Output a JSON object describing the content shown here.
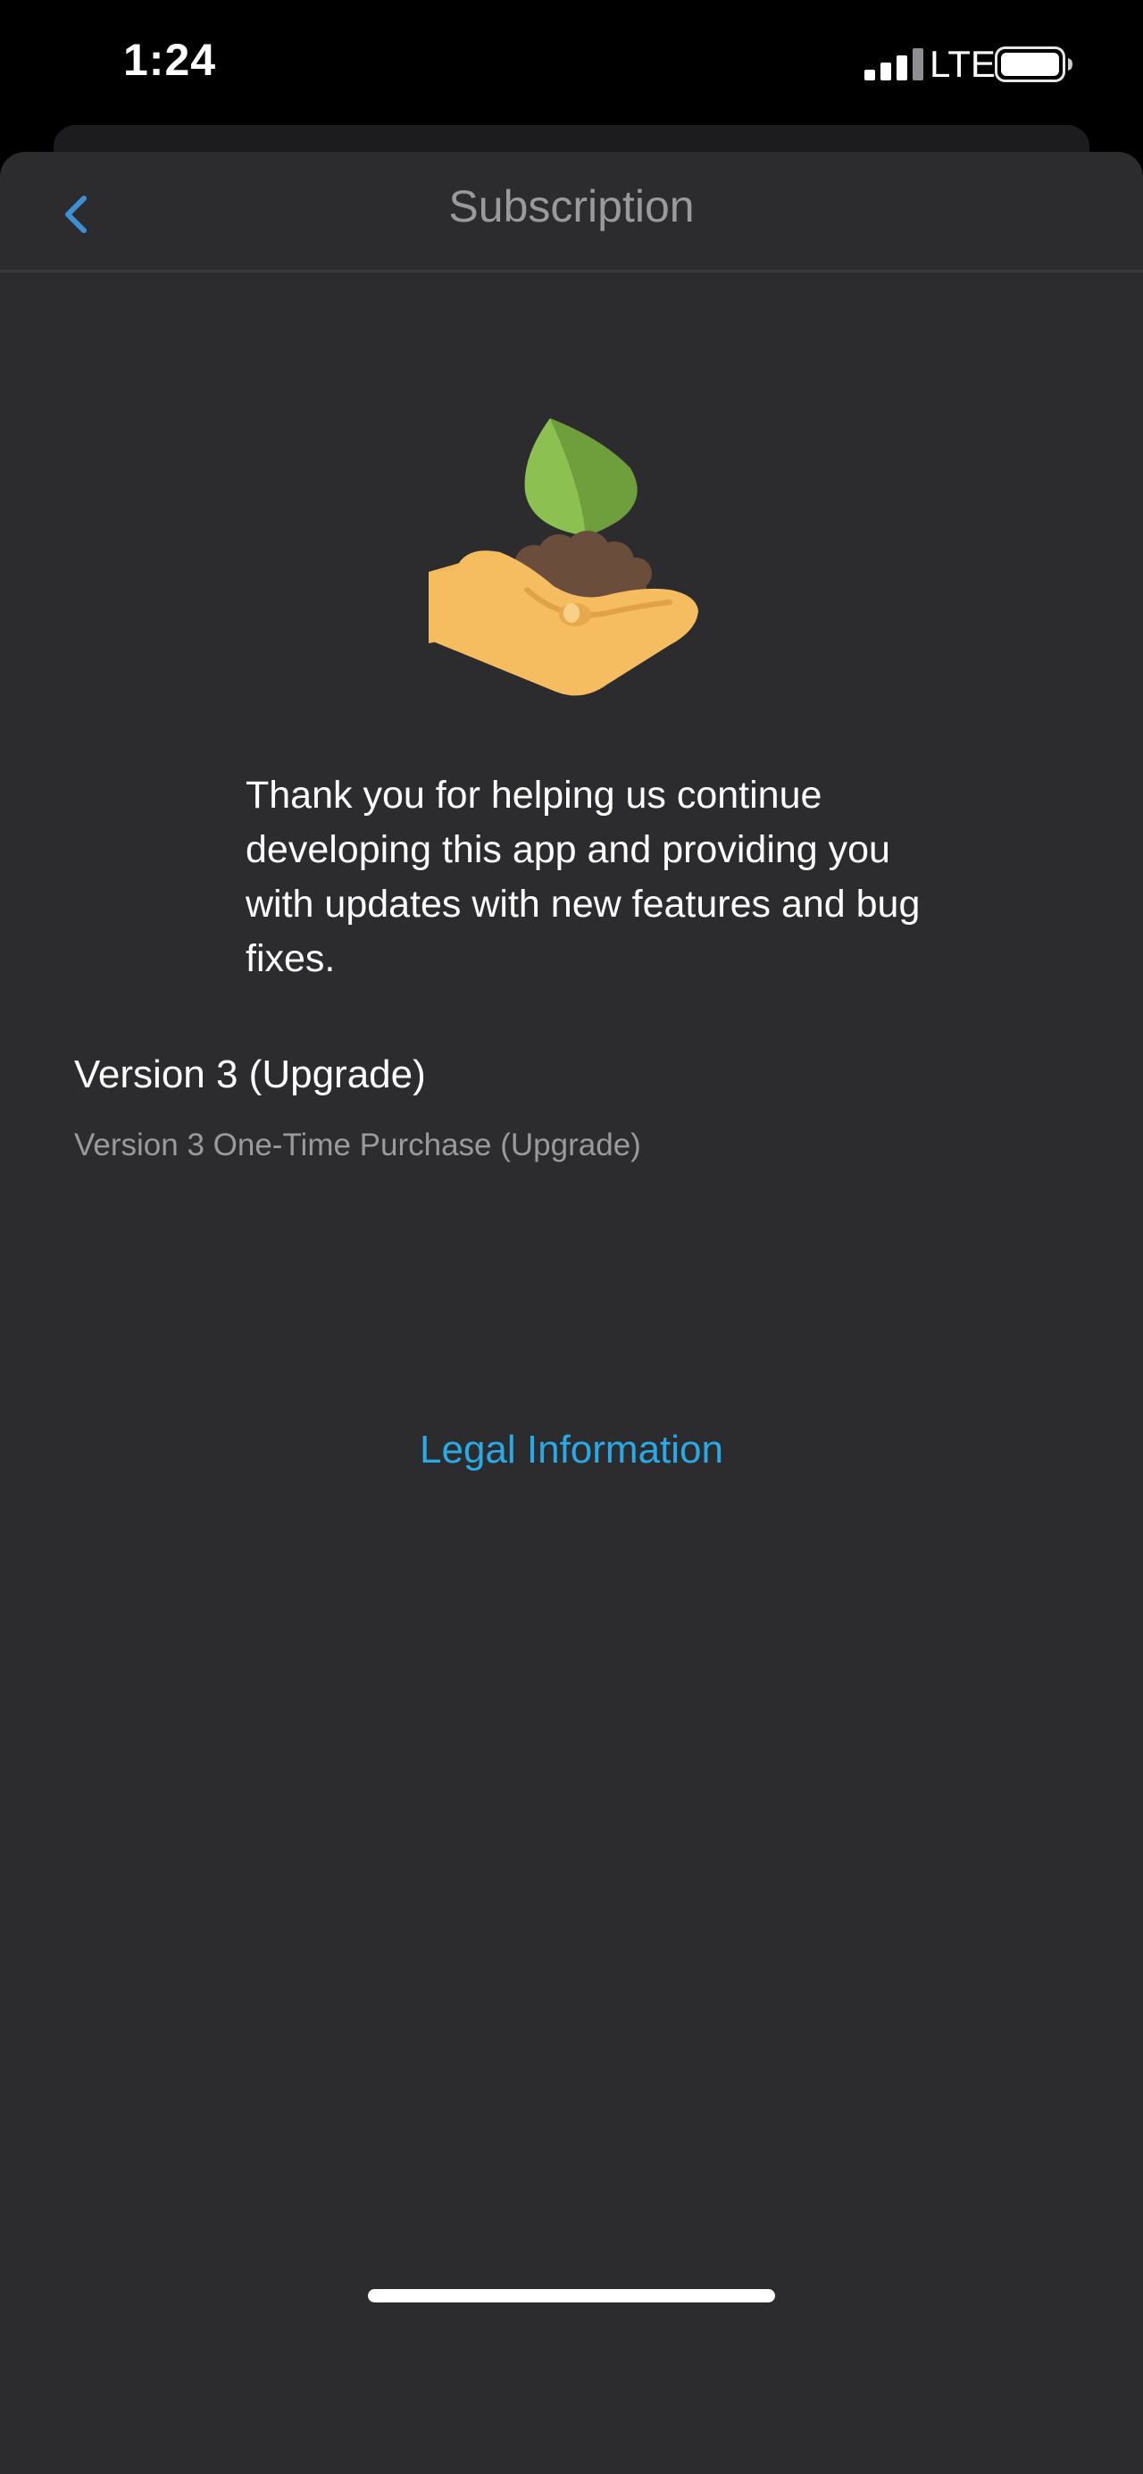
{
  "status_bar": {
    "time": "1:24",
    "carrier": "LTE",
    "icons": [
      "signal-icon",
      "battery-icon"
    ]
  },
  "nav": {
    "title": "Subscription",
    "back_icon": "chevron-left-icon"
  },
  "illustration": {
    "icon": "hand-holding-plant-icon"
  },
  "message": "Thank you for helping us continue developing this app and providing you with updates with new features and bug fixes.",
  "product": {
    "title": "Version 3 (Upgrade)",
    "subtitle": "Version 3 One-Time Purchase (Upgrade)"
  },
  "legal_link": "Legal Information",
  "colors": {
    "background": "#2c2c2e",
    "accent": "#29a9e6",
    "back_chevron": "#3d8fd6",
    "title_gray": "#9a9a9e"
  }
}
